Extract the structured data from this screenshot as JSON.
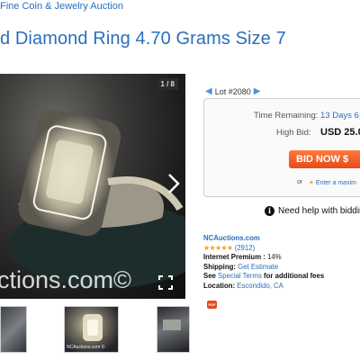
{
  "breadcrumb": "Fine Coin & Jewelry Auction",
  "title": "d Diamond Ring 4.70 Grams Size 7",
  "gallery": {
    "counter": "1 / 8",
    "watermark": "ctions.com©",
    "thumb_caption": "NCAuctions.com ©"
  },
  "lot": {
    "label": "Lot #2080"
  },
  "bid_box": {
    "time_label": "Time Remaining:",
    "time_value": "13 Days 6",
    "bid_label": "High Bid:",
    "bid_value": "USD 25.0",
    "bid_button": "BID NOW $",
    "or": "or",
    "max_link": "Enter a maxim"
  },
  "help": "Need help with biddin",
  "seller": {
    "name": "NCAuctions.com",
    "stars": "★★★★★",
    "reviews": "(2912)",
    "premium_label": "Internet Premium :",
    "premium_value": "14%",
    "shipping_label": "Shipping:",
    "shipping_link": "Get Estimate",
    "see": "See",
    "special_terms": "Special Terms",
    "additional_fees": "for additional fees",
    "location_label": "Location:",
    "location_value": "Escondido, CA"
  },
  "colors": {
    "link": "#2a6ebb",
    "bid_button": "#e8491d",
    "stars": "#f0a11b"
  }
}
